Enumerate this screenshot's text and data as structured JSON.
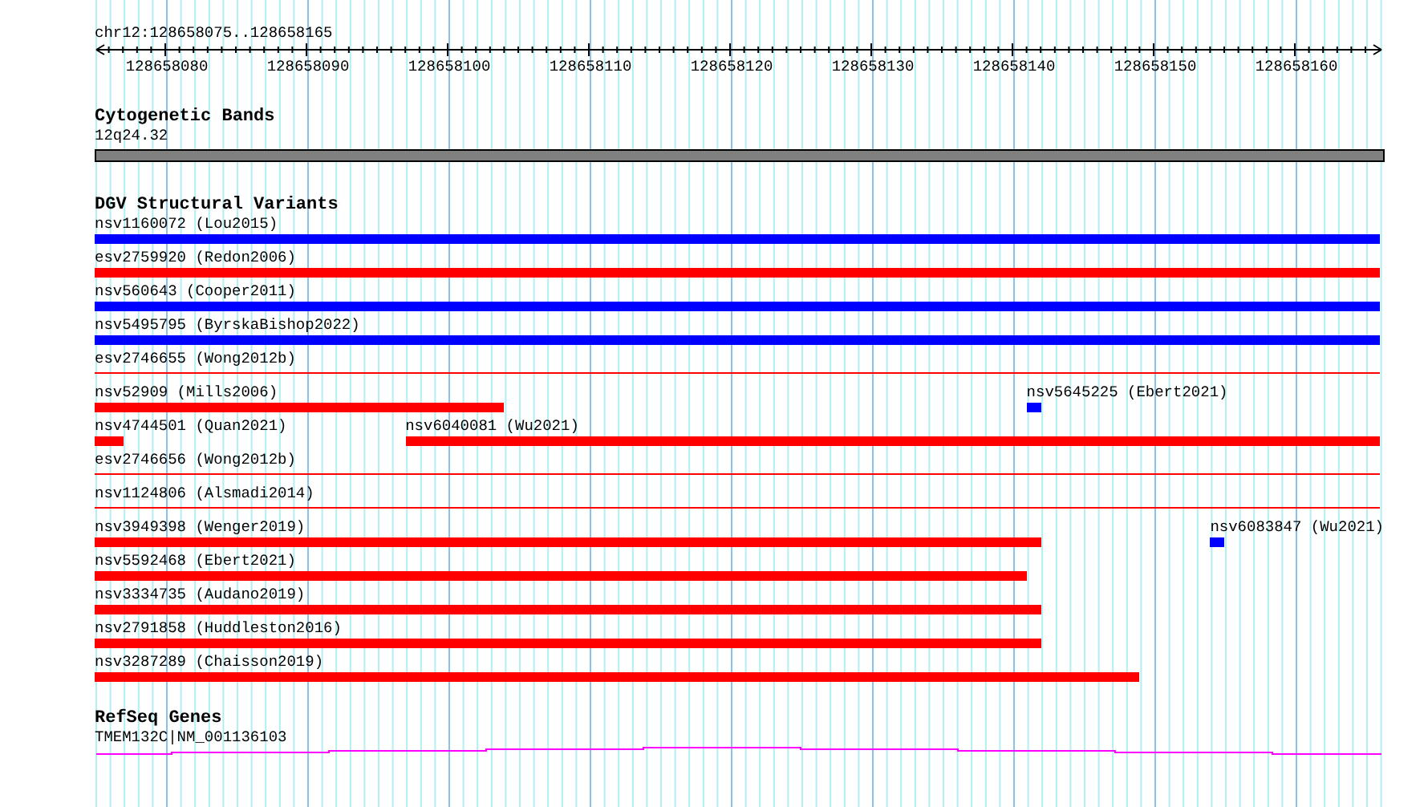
{
  "ruler": {
    "region": "chr12:128658075..128658165",
    "labels": [
      "128658080",
      "128658090",
      "128658100",
      "128658110",
      "128658120",
      "128658130",
      "128658140",
      "128658150",
      "128658160"
    ]
  },
  "cytogenetic_bands": {
    "title": "Cytogenetic Bands",
    "band": "12q24.32"
  },
  "dgv": {
    "title": "DGV Structural Variants",
    "rows": [
      {
        "features": [
          {
            "label": "nsv1160072 (Lou2015)",
            "kind": "bar",
            "color": "#0000ff"
          }
        ]
      },
      {
        "features": [
          {
            "label": "esv2759920 (Redon2006)",
            "kind": "bar",
            "color": "#ff0000"
          }
        ]
      },
      {
        "features": [
          {
            "label": "nsv560643 (Cooper2011)",
            "kind": "bar",
            "color": "#0000ff"
          }
        ]
      },
      {
        "features": [
          {
            "label": "nsv5495795 (ByrskaBishop2022)",
            "kind": "bar",
            "color": "#0000ff"
          }
        ]
      },
      {
        "features": [
          {
            "label": "esv2746655 (Wong2012b)",
            "kind": "line",
            "color": "#ff0000"
          }
        ]
      },
      {
        "features": [
          {
            "label": "nsv52909 (Mills2006)",
            "kind": "bar",
            "color": "#ff0000"
          },
          {
            "label": "nsv5645225 (Ebert2021)",
            "kind": "bar",
            "color": "#0000ff"
          }
        ]
      },
      {
        "features": [
          {
            "label": "nsv4744501 (Quan2021)",
            "kind": "bar",
            "color": "#ff0000"
          },
          {
            "label": "nsv6040081 (Wu2021)",
            "kind": "bar",
            "color": "#ff0000"
          }
        ]
      },
      {
        "features": [
          {
            "label": "esv2746656 (Wong2012b)",
            "kind": "line",
            "color": "#ff0000"
          }
        ]
      },
      {
        "features": [
          {
            "label": "nsv1124806 (Alsmadi2014)",
            "kind": "line",
            "color": "#ff0000"
          }
        ]
      },
      {
        "features": [
          {
            "label": "nsv3949398 (Wenger2019)",
            "kind": "bar",
            "color": "#ff0000"
          },
          {
            "label": "nsv6083847 (Wu2021)",
            "kind": "bar",
            "color": "#0000ff"
          }
        ]
      },
      {
        "features": [
          {
            "label": "nsv5592468 (Ebert2021)",
            "kind": "bar",
            "color": "#ff0000"
          }
        ]
      },
      {
        "features": [
          {
            "label": "nsv3334735 (Audano2019)",
            "kind": "bar",
            "color": "#ff0000"
          }
        ]
      },
      {
        "features": [
          {
            "label": "nsv2791858 (Huddleston2016)",
            "kind": "bar",
            "color": "#ff0000"
          }
        ]
      },
      {
        "features": [
          {
            "label": "nsv3287289 (Chaisson2019)",
            "kind": "bar",
            "color": "#ff0000"
          }
        ]
      }
    ]
  },
  "refseq_genes": {
    "title": "RefSeq Genes",
    "gene": "TMEM132C|NM_001136103"
  }
}
